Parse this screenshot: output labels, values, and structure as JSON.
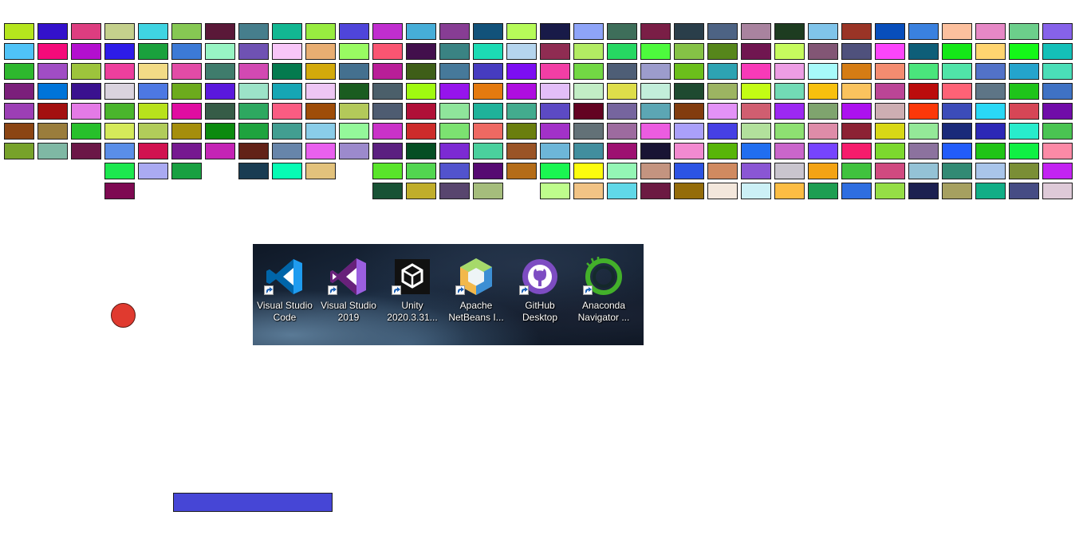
{
  "game": {
    "brick_columns": [
      [
        "#b5e61d",
        "#4fc3f7",
        "#2eb82e",
        "#7b1f7b",
        "#9c3fb5",
        "#8b4513",
        "#77a22a"
      ],
      [
        "#3311cc",
        "#f50a7a",
        "#a04dc4",
        "#0074d9",
        "#a31010",
        "#9a7d3c",
        "#7fb8a4"
      ],
      [
        "#dd3d80",
        "#b30fcf",
        "#9dc43c",
        "#3a118f",
        "#e47ae6",
        "#27c02b",
        "#6b1747"
      ],
      [
        "#c4d08c",
        "#2d1ce8",
        "#ed3f9d",
        "#dad3de",
        "#4ab52c",
        "#d5ea5a",
        "#5a8ee8",
        "#1ce84f",
        "#7e0a52"
      ],
      [
        "#3fd4e2",
        "#1aa13d",
        "#f2db86",
        "#4d78e3",
        "#b8e21c",
        "#b1cc5a",
        "#d11250",
        "#aaaaf2"
      ],
      [
        "#86c853",
        "#3c7ad6",
        "#e24ba6",
        "#6cab1d",
        "#e00da1",
        "#a58e0c",
        "#761990",
        "#18a041"
      ],
      [
        "#5a1838",
        "#98f5c4",
        "#3f7c6c",
        "#5a18dd",
        "#365c47",
        "#0b8a0f",
        "#c424b5"
      ],
      [
        "#467e8c",
        "#6f52b3",
        "#d249b2",
        "#9ce3c8",
        "#2ea860",
        "#1ea33e",
        "#622218",
        "#193c52"
      ],
      [
        "#12b792",
        "#f8c6f8",
        "#047a4e",
        "#16a6b4",
        "#fa5c82",
        "#429e91",
        "#6785aa",
        "#07fcb4"
      ],
      [
        "#98ec40",
        "#e8ae72",
        "#d3aa0b",
        "#eec6f4",
        "#9e4d08",
        "#8acde8",
        "#e960ee",
        "#e2c27c"
      ],
      [
        "#4f45da",
        "#99fb62",
        "#44708f",
        "#1a5c20",
        "#b3c95a",
        "#94f89a",
        "#9c8acc"
      ],
      [
        "#c02ecf",
        "#fa5572",
        "#b91e98",
        "#4b5f6a",
        "#4e5c71",
        "#ca32c8",
        "#5b2080",
        "#59e52a",
        "#185235"
      ],
      [
        "#46aed8",
        "#420f4c",
        "#3e5e18",
        "#a0fa10",
        "#b01038",
        "#cd2b2b",
        "#054e23",
        "#52d650",
        "#c0ae2a"
      ],
      [
        "#873d94",
        "#3a8383",
        "#46799a",
        "#9614ec",
        "#8fe59b",
        "#7ce271",
        "#7c2ad3",
        "#5253cd",
        "#58456e"
      ],
      [
        "#12527a",
        "#1cdbb4",
        "#463cc0",
        "#e47a0f",
        "#1fb29a",
        "#ee6962",
        "#4ad09d",
        "#560a72",
        "#a5bd7c"
      ],
      [
        "#b6fb59",
        "#b5d5ee",
        "#7c0ef2",
        "#ae0ee0",
        "#43ab8e",
        "#6a7e0e",
        "#9a5426",
        "#b46c18"
      ],
      [
        "#181a48",
        "#8f2c52",
        "#f23ea5",
        "#e3bef8",
        "#5c4ac4",
        "#a231c8",
        "#6db6d8",
        "#1af651",
        "#befc8c"
      ],
      [
        "#8ea4f8",
        "#b2ec63",
        "#72d844",
        "#c2edc5",
        "#630322",
        "#637177",
        "#428e9e",
        "#fcfc0e",
        "#f1c385"
      ],
      [
        "#3e6e5a",
        "#26d862",
        "#4e5e76",
        "#dede4a",
        "#76659e",
        "#9d6b9f",
        "#9d1171",
        "#94f6b5",
        "#60d8e8"
      ],
      [
        "#7a1e46",
        "#4dfa3d",
        "#9c9ccc",
        "#c2eeda",
        "#5ca6b4",
        "#ec5ce0",
        "#191434",
        "#c49480",
        "#6c1a42"
      ],
      [
        "#2a3e4a",
        "#85c246",
        "#6bbf1b",
        "#1e4a30",
        "#823c0e",
        "#aaa0fa",
        "#f28ad0",
        "#2c54e4",
        "#946c0a"
      ],
      [
        "#4d6384",
        "#56861b",
        "#2da3b2",
        "#9cb462",
        "#e392f7",
        "#4640e4",
        "#58b508",
        "#d08a60",
        "#f3e7dc"
      ],
      [
        "#a9839f",
        "#701650",
        "#f83ab8",
        "#c3fc14",
        "#d05e70",
        "#b2e09c",
        "#216ef0",
        "#8a56d4",
        "#ccf0f6"
      ],
      [
        "#1d3c20",
        "#c6fb5e",
        "#ed9de4",
        "#72dbb5",
        "#9c28f2",
        "#8ee072",
        "#ca66cb",
        "#c9c5ce",
        "#fcbd44"
      ],
      [
        "#80c4ea",
        "#825675",
        "#a7fafa",
        "#f8c00e",
        "#7fa46e",
        "#de8ca8",
        "#7644fe",
        "#f3a314",
        "#1e9e52"
      ],
      [
        "#9a3426",
        "#4f517c",
        "#d57c14",
        "#fac35e",
        "#ac12ef",
        "#8c2234",
        "#f61c6c",
        "#40c23e",
        "#2e6ee0"
      ],
      [
        "#084ebb",
        "#fc45fb",
        "#f48c70",
        "#bb4596",
        "#cdaeb2",
        "#d8d816",
        "#7cd82e",
        "#d04a80",
        "#95de46"
      ],
      [
        "#3a81df",
        "#0e5e78",
        "#4ae57c",
        "#bb0c0c",
        "#fc3809",
        "#94e898",
        "#8c729e",
        "#94c2d6",
        "#1c2050"
      ],
      [
        "#fcc09e",
        "#14e818",
        "#50e4a8",
        "#fe6276",
        "#3c4cb9",
        "#1a2a7a",
        "#225cfa",
        "#328a74",
        "#a6a060"
      ],
      [
        "#e688c6",
        "#ffd570",
        "#5272c8",
        "#5e7586",
        "#2ad8f6",
        "#2c28b6",
        "#20c416",
        "#a9c5ea",
        "#12ae86"
      ],
      [
        "#6ccf8b",
        "#14f818",
        "#24a4cc",
        "#1ec41a",
        "#d64656",
        "#28eccc",
        "#10f044",
        "#7a8e36",
        "#464c84"
      ],
      [
        "#8662ea",
        "#14c0b8",
        "#4adeb8",
        "#3f72c4",
        "#700ca8",
        "#4ac452",
        "#fc8aa6",
        "#c324f2",
        "#decad8"
      ]
    ],
    "paddle": {
      "color": "#4646d6"
    },
    "ball": {
      "color": "#e03a2f"
    }
  },
  "desktop_icons": [
    {
      "name": "vscode-icon",
      "label": "Visual Studio\nCode"
    },
    {
      "name": "visual-studio-icon",
      "label": "Visual Studio\n2019"
    },
    {
      "name": "unity-icon",
      "label": "Unity\n2020.3.31..."
    },
    {
      "name": "netbeans-icon",
      "label": "Apache\nNetBeans I..."
    },
    {
      "name": "github-desktop-icon",
      "label": "GitHub\nDesktop"
    },
    {
      "name": "anaconda-icon",
      "label": "Anaconda\nNavigator ..."
    }
  ]
}
